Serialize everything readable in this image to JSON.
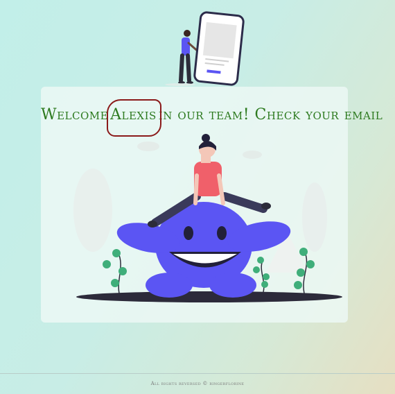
{
  "welcome": {
    "prefix": "Welcome",
    "name": "Alexis",
    "suffix": "in our team! Check your email"
  },
  "footer": {
    "text": "All rights reversed © ringerflorine"
  },
  "colors": {
    "heading": "#2d7a1f",
    "accent": "#5b55f3",
    "circle": "#8b1a1a"
  }
}
